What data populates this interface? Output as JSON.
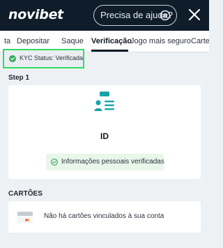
{
  "header": {
    "logo": "novibet",
    "help_text": "Precisa de ajuda?"
  },
  "tabs": [
    {
      "label": "ta"
    },
    {
      "label": "Depositar"
    },
    {
      "label": "Saque"
    },
    {
      "label": "Verificação",
      "active": true
    },
    {
      "label": "Jogo mais seguro"
    },
    {
      "label": "Carte"
    }
  ],
  "kyc": {
    "status_text": "KYC Status: Verificada"
  },
  "step": {
    "label": "Step 1",
    "card_title": "ID",
    "verified_text": "Informações pessoais verificadas"
  },
  "cards": {
    "label": "CARTÕES",
    "empty_text": "Não há cartões vinculados à sua conta"
  },
  "colors": {
    "header_bg": "#0f1c2a",
    "highlight": "#2fdc63",
    "success": "#3aaa5c",
    "accent": "#17a4a8"
  },
  "icons": {
    "help": "chat-bubble-icon",
    "close": "close-icon",
    "kyc": "check-circle-icon",
    "id": "id-card-icon",
    "verified": "check-circle-outline-icon",
    "card": "credit-card-icon"
  }
}
